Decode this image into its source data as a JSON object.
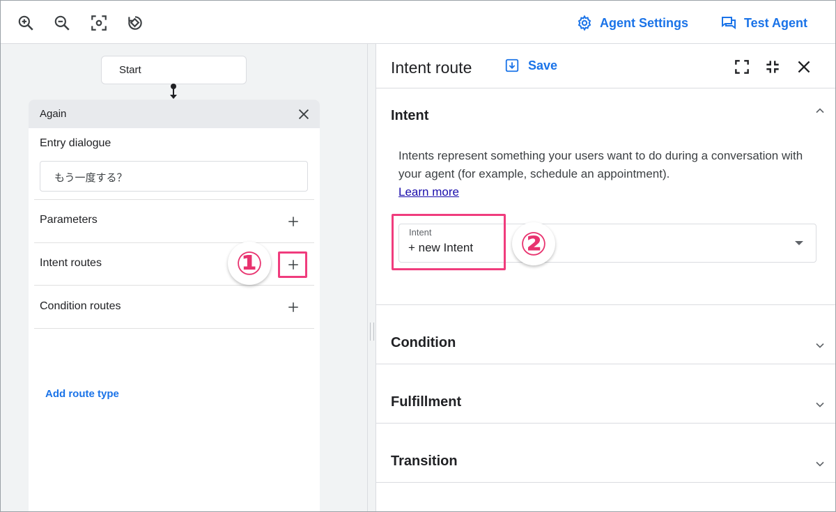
{
  "toolbar": {
    "tools": [
      "zoom-in-icon",
      "zoom-out-icon",
      "focus-icon",
      "rotate-icon"
    ],
    "agent_settings_label": "Agent Settings",
    "test_agent_label": "Test Agent"
  },
  "canvas": {
    "start_label": "Start",
    "page": {
      "title": "Again",
      "entry_dialogue_label": "Entry dialogue",
      "entry_dialogue_value": "もう一度する？",
      "parameters_label": "Parameters",
      "intent_routes_label": "Intent routes",
      "condition_routes_label": "Condition routes",
      "add_route_type_label": "Add route type"
    }
  },
  "annotations": {
    "step1": "①",
    "step2": "②",
    "highlight_color": "#f03c7d"
  },
  "panel": {
    "title": "Intent route",
    "save_label": "Save",
    "sections": {
      "intent": {
        "title": "Intent",
        "description": "Intents represent something your users want to do during a conversation with your agent (for example, schedule an appointment).",
        "learn_more": "Learn more",
        "field_label": "Intent",
        "field_value": "+ new Intent"
      },
      "condition": {
        "title": "Condition"
      },
      "fulfillment": {
        "title": "Fulfillment"
      },
      "transition": {
        "title": "Transition"
      }
    }
  },
  "colors": {
    "accent": "#1a73e8",
    "canvas_bg": "#f1f3f4",
    "highlight": "#f03c7d"
  }
}
